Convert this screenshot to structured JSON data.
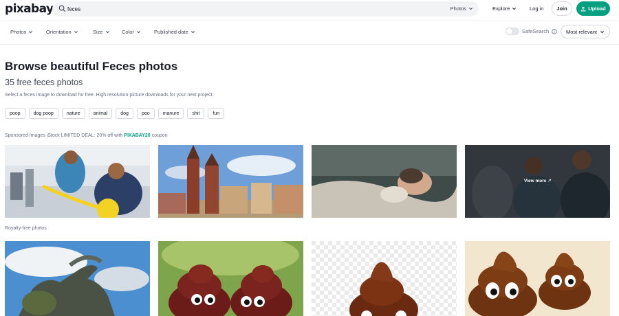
{
  "brand": {
    "logo": "pixabay",
    "accent": "#05a081"
  },
  "search": {
    "value": "feces",
    "type_label": "Photos"
  },
  "nav": {
    "explore": "Explore",
    "login": "Log in",
    "join": "Join",
    "upload": "Upload"
  },
  "filters": [
    "Photos",
    "Orientation",
    "Size",
    "Color",
    "Published date"
  ],
  "safesearch": {
    "label": "SafeSearch",
    "enabled": false
  },
  "sort": {
    "label": "Most relevant"
  },
  "page": {
    "title": "Browse beautiful Feces photos",
    "count_title": "35 free feces photos",
    "description": "Select a feces image to download for free. High resolution picture downloads for your next project."
  },
  "tags": [
    "poop",
    "dog poop",
    "nature",
    "animal",
    "dog",
    "poo",
    "manure",
    "shit",
    "fun"
  ],
  "sponsored": {
    "prefix": "Sponsored Images iStock LIMITED DEAL: 20% off with ",
    "code": "PIXABAY20",
    "suffix": " coupon"
  },
  "royalty_label": "Royalty-free photos",
  "view_more": "View more",
  "icons": {
    "search": "search-icon",
    "upload": "upload-icon",
    "info": "info-icon",
    "chevron": "chevron-down-icon",
    "external": "external-link-icon"
  }
}
